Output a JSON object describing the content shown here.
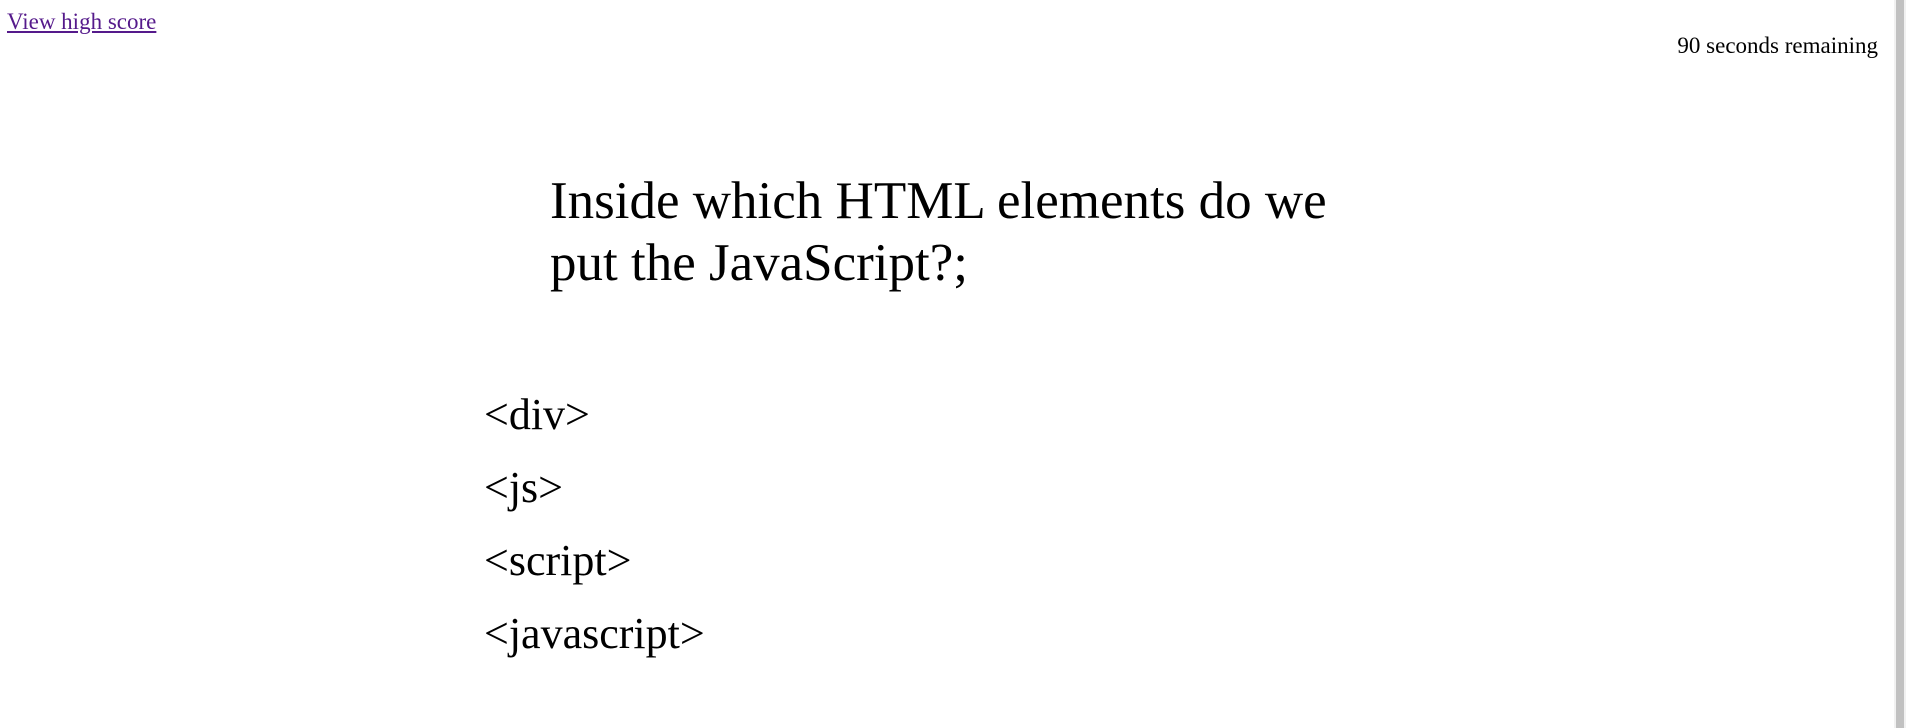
{
  "header": {
    "high_score_label": "View high score",
    "timer_text": "90 seconds remaining"
  },
  "quiz": {
    "question": "Inside which HTML elements do we put the JavaScript?;",
    "choices": [
      "<div>",
      "<js>",
      "<script>",
      "<javascript>"
    ]
  },
  "colors": {
    "link_visited": "#551a8b",
    "text": "#000000",
    "background": "#ffffff",
    "scrollbar_thumb": "#c1c1c1"
  }
}
